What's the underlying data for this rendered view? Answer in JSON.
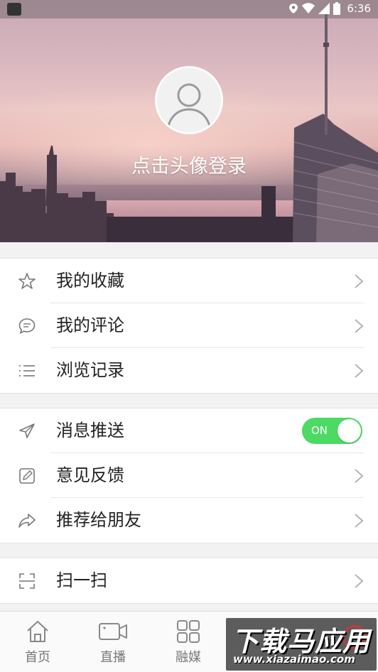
{
  "status_bar": {
    "time": "6:36"
  },
  "profile": {
    "login_text": "点击头像登录"
  },
  "group1": [
    {
      "label": "我的收藏",
      "icon": "star-icon"
    },
    {
      "label": "我的评论",
      "icon": "comment-icon"
    },
    {
      "label": "浏览记录",
      "icon": "list-icon"
    }
  ],
  "group2": [
    {
      "label": "消息推送",
      "icon": "send-icon",
      "toggle": {
        "text": "ON",
        "on": true
      }
    },
    {
      "label": "意见反馈",
      "icon": "edit-icon"
    },
    {
      "label": "推荐给朋友",
      "icon": "share-icon"
    }
  ],
  "group3": [
    {
      "label": "扫一扫",
      "icon": "scan-icon"
    }
  ],
  "bottom_nav": [
    {
      "label": "首页",
      "icon": "home-icon"
    },
    {
      "label": "直播",
      "icon": "video-icon"
    },
    {
      "label": "融媒",
      "icon": "grid-icon"
    }
  ],
  "watermark": {
    "main": "下载马应用",
    "url": "www.xiazaimao.com"
  },
  "colors": {
    "toggle_on": "#4cd964",
    "text": "#222222",
    "nav_label": "#777777"
  }
}
